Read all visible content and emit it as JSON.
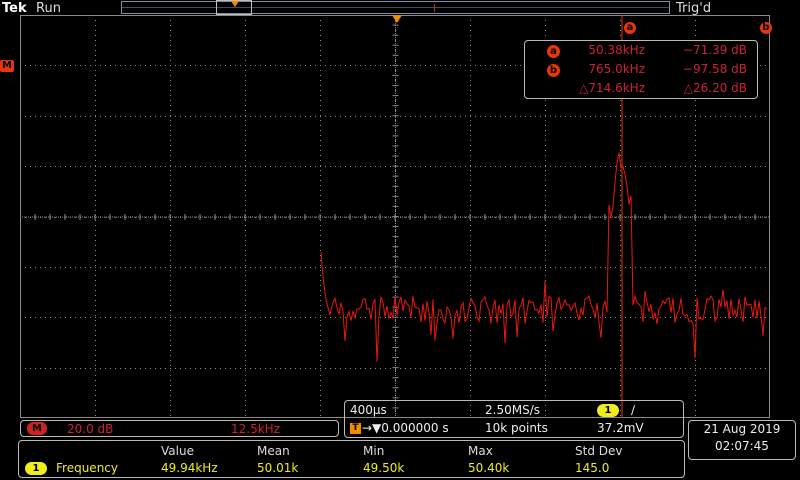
{
  "header": {
    "brand": "Tek",
    "run_state": "Run",
    "trigger_state": "Trig'd"
  },
  "markers": {
    "math": "M",
    "cursor_a": "a",
    "cursor_b": "b"
  },
  "cursor_readout": {
    "a": {
      "label": "a",
      "freq": "50.38kHz",
      "db": "−71.39 dB"
    },
    "b": {
      "label": "b",
      "freq": "765.0kHz",
      "db": "−97.58 dB"
    },
    "delta": {
      "freq": "△714.6kHz",
      "db": "△26.20 dB"
    }
  },
  "channel_info": {
    "badge": "M",
    "scale": "20.0 dB",
    "res_bw": "12.5kHz"
  },
  "timebase": {
    "time_per_div": "400µs",
    "sample_rate": "2.50MS/s",
    "trigger_channel": "1",
    "trigger_slope": "∕",
    "trigger_position_badge": "T",
    "trigger_position": "→▼0.000000 s",
    "record_length": "10k points",
    "trigger_level": "37.2mV"
  },
  "datetime": {
    "date": "21 Aug 2019",
    "time": "02:07:45"
  },
  "measurements": {
    "headers": [
      "Value",
      "Mean",
      "Min",
      "Max",
      "Std Dev"
    ],
    "rows": [
      {
        "channel": "1",
        "name": "Frequency",
        "value": "49.94kHz",
        "mean": "50.01k",
        "min": "49.50k",
        "max": "50.40k",
        "std_dev": "145.0"
      }
    ]
  },
  "colors": {
    "trace": "#e8180c",
    "cursor": "#e8360a",
    "trigger_marker": "#f28b00",
    "channel1": "#f1ec1c",
    "grid": "#8a8a8a"
  }
}
